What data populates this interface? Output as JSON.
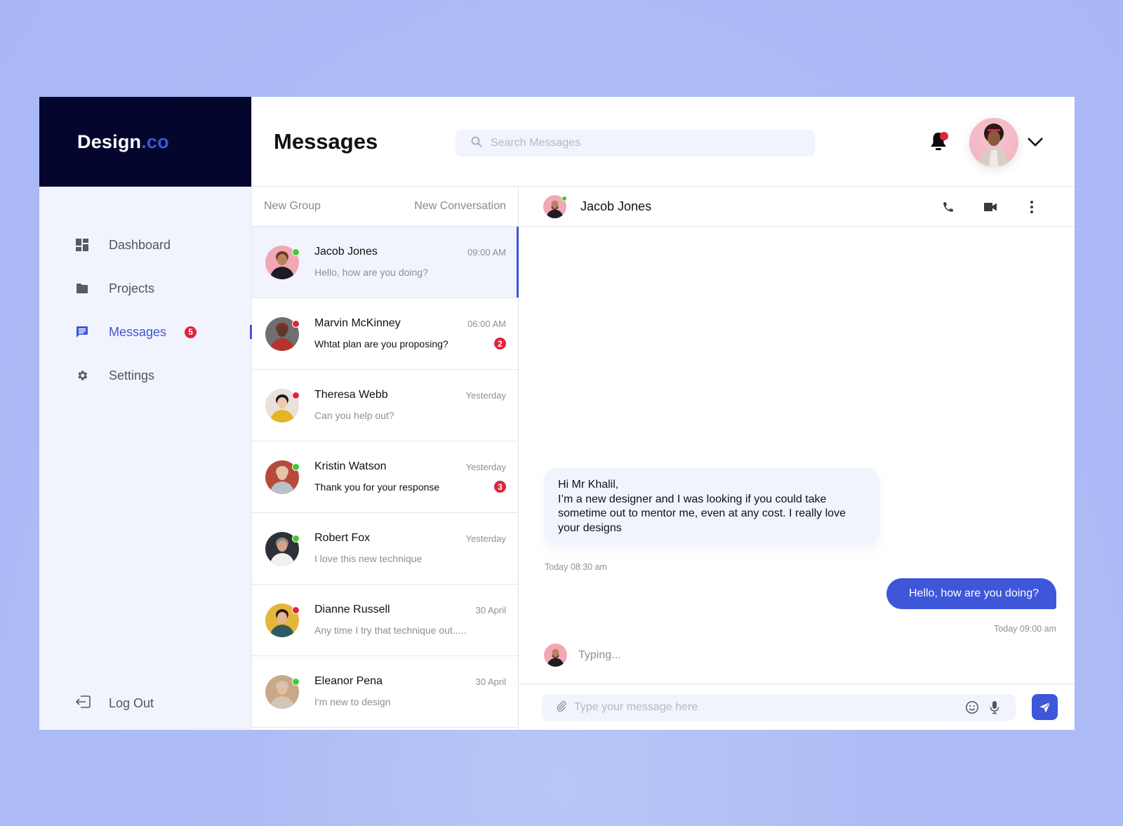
{
  "brand": {
    "name": "Design",
    "suffix": ".co"
  },
  "colors": {
    "accent": "#3e56d8",
    "sidebar_dark": "#05062d",
    "surface": "#f1f4fc",
    "online": "#3fcc2f",
    "alert": "#e0243b",
    "page_bg": "#aebcf6"
  },
  "sidebar": {
    "items": [
      {
        "label": "Dashboard",
        "icon": "dashboard-icon",
        "active": false
      },
      {
        "label": "Projects",
        "icon": "folder-icon",
        "active": false
      },
      {
        "label": "Messages",
        "icon": "message-icon",
        "active": true,
        "badge": "5"
      },
      {
        "label": "Settings",
        "icon": "gear-icon",
        "active": false
      }
    ],
    "logout_label": "Log Out"
  },
  "header": {
    "title": "Messages",
    "search_placeholder": "Search Messages",
    "notifications_unread": true
  },
  "conversation_list": {
    "new_group_label": "New Group",
    "new_conversation_label": "New Conversation",
    "items": [
      {
        "name": "Jacob Jones",
        "time": "09:00 AM",
        "preview": "Hello, how are you doing?",
        "status": "online",
        "unread": null,
        "selected": true
      },
      {
        "name": "Marvin McKinney",
        "time": "06:00 AM",
        "preview": "Whtat plan are you proposing?",
        "status": "offline",
        "unread": "2",
        "selected": false
      },
      {
        "name": "Theresa Webb",
        "time": "Yesterday",
        "preview": "Can you help out?",
        "status": "offline",
        "unread": null,
        "selected": false
      },
      {
        "name": "Kristin Watson",
        "time": "Yesterday",
        "preview": "Thank you for your response",
        "status": "online",
        "unread": "3",
        "selected": false
      },
      {
        "name": "Robert Fox",
        "time": "Yesterday",
        "preview": "I love this new technique",
        "status": "online",
        "unread": null,
        "selected": false
      },
      {
        "name": "Dianne Russell",
        "time": "30 April",
        "preview": "Any time I try that technique out.....",
        "status": "offline",
        "unread": null,
        "selected": false
      },
      {
        "name": "Eleanor Pena",
        "time": "30 April",
        "preview": "I'm new to design",
        "status": "online",
        "unread": null,
        "selected": false
      }
    ]
  },
  "chat": {
    "contact_name": "Jacob Jones",
    "contact_status": "online",
    "messages": [
      {
        "direction": "incoming",
        "text": "Hi Mr Khalil,\nI’m a new designer and I was looking if you could take sometime out to mentor me, even at any cost. I really love your designs",
        "timestamp": "Today 08:30 am"
      },
      {
        "direction": "outgoing",
        "text": "Hello, how are you doing?",
        "timestamp": "Today 09:00 am"
      }
    ],
    "typing_label": "Typing...",
    "composer_placeholder": "Type your message here"
  }
}
